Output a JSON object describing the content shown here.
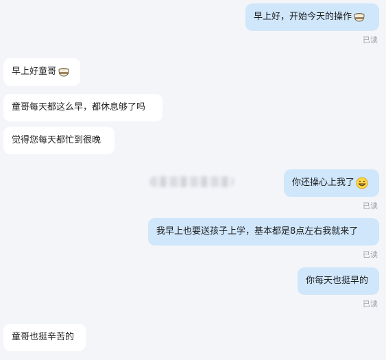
{
  "messages": [
    {
      "id": "m1",
      "side": "out",
      "text": "早上好，开始今天的操作",
      "emoji": "tea-icon",
      "read": "已读"
    },
    {
      "id": "m2",
      "side": "in",
      "text": "早上好童哥",
      "emoji": "tea-icon"
    },
    {
      "id": "m3",
      "side": "in",
      "text": "童哥每天都这么早，都休息够了吗"
    },
    {
      "id": "m4",
      "side": "in",
      "text": "觉得您每天都忙到很晚"
    },
    {
      "id": "m5",
      "side": "out",
      "text": "你还操心上我了",
      "emoji": "grin-icon",
      "read": "已读"
    },
    {
      "id": "m6",
      "side": "out",
      "text": "我早上也要送孩子上学，基本都是8点左右我就来了",
      "read": "已读"
    },
    {
      "id": "m7",
      "side": "out",
      "text": "你每天也挺早的",
      "read": "已读"
    },
    {
      "id": "m8",
      "side": "in",
      "text": "童哥也挺辛苦的"
    }
  ],
  "colors": {
    "background": "#f4f5f9",
    "outgoing_bubble": "#cfe6fb",
    "incoming_bubble": "#ffffff",
    "read_text": "#9aa0a6"
  }
}
